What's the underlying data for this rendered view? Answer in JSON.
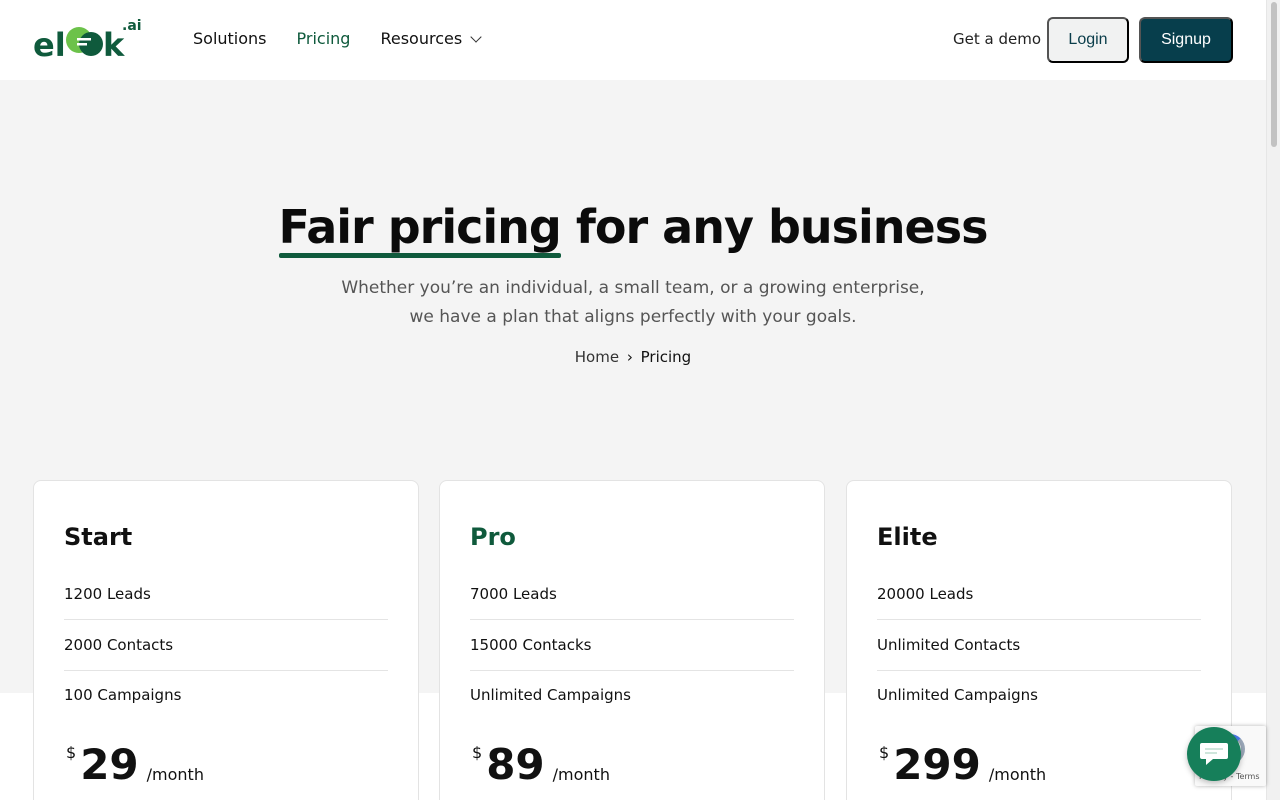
{
  "header": {
    "logo_suffix": ".ai",
    "nav": [
      {
        "label": "Solutions",
        "active": false
      },
      {
        "label": "Pricing",
        "active": true
      },
      {
        "label": "Resources",
        "active": false,
        "has_dropdown": true
      }
    ],
    "demo_label": "Get a demo",
    "login_label": "Login",
    "signup_label": "Signup"
  },
  "hero": {
    "title_highlight": "Fair pricing",
    "title_rest": " for any business",
    "subtitle_line1": "Whether you’re an individual, a small team, or a growing enterprise,",
    "subtitle_line2": "we have a plan that aligns perfectly with your goals.",
    "breadcrumb": {
      "home": "Home",
      "separator": "›",
      "current": "Pricing"
    }
  },
  "plans": [
    {
      "name": "Start",
      "features": [
        "1200 Leads",
        "2000 Contacts",
        "100 Campaigns"
      ],
      "currency": "$",
      "price": "29",
      "period": "/month"
    },
    {
      "name": "Pro",
      "features": [
        "7000 Leads",
        "15000 Contacks",
        "Unlimited Campaigns"
      ],
      "currency": "$",
      "price": "89",
      "period": "/month"
    },
    {
      "name": "Elite",
      "features": [
        "20000 Leads",
        "Unlimited Contacts",
        "Unlimited Campaigns"
      ],
      "currency": "$",
      "price": "299",
      "period": "/month"
    }
  ],
  "recaptcha": {
    "text": "Privacy - Terms"
  },
  "colors": {
    "brand_green": "#0f5a3c",
    "signup_bg": "#073e4c",
    "hero_bg": "#f4f4f4",
    "chat_bg": "#167f5a"
  },
  "icons": {
    "logo": "elook-logo",
    "chat": "chat-bubble-icon",
    "dropdown": "chevron-down-icon"
  }
}
